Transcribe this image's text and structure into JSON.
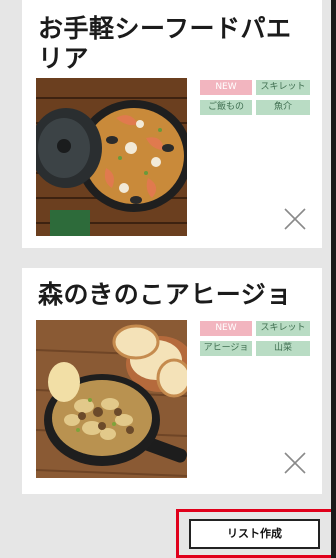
{
  "recipes": [
    {
      "title": "お手軽シーフードパエリア",
      "tags": [
        "NEW",
        "スキレット",
        "ご飯もの",
        "魚介"
      ]
    },
    {
      "title": "森のきのこアヒージョ",
      "tags": [
        "NEW",
        "スキレット",
        "アヒージョ",
        "山菜"
      ]
    }
  ],
  "actions": {
    "create_list_label": "リスト作成"
  },
  "icons": {
    "close": "close-icon"
  },
  "colors": {
    "tag_new": "#f2b5bf",
    "tag_category": "#b9dcc4",
    "highlight_border": "#e0001b"
  }
}
